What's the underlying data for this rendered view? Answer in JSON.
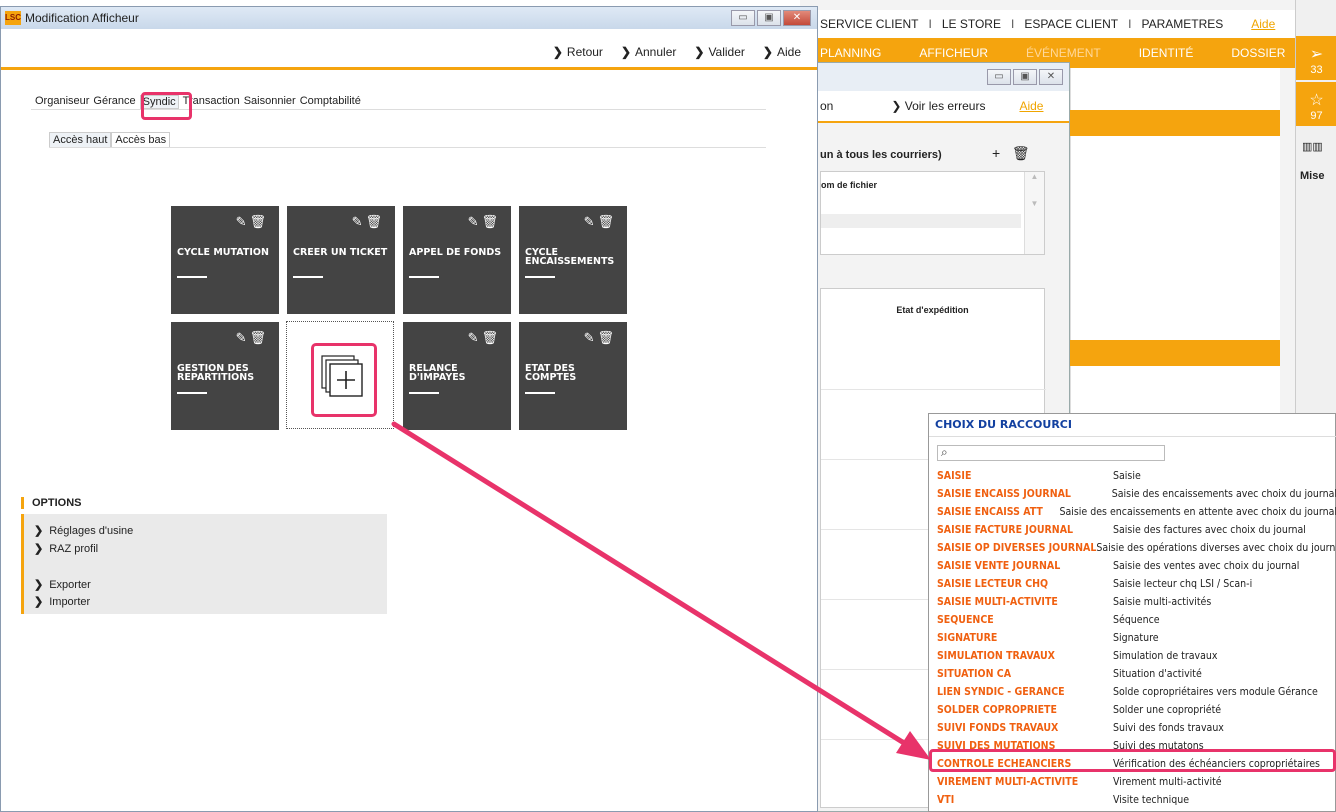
{
  "bg_app": {
    "topnav": [
      "SERVICE CLIENT",
      "LE STORE",
      "ESPACE CLIENT",
      "PARAMETRES"
    ],
    "topnav_sep": "I",
    "aide": "Aide",
    "orangebar": [
      "PLANNING",
      "AFFICHEUR",
      "ÉVÉNEMENT",
      "IDENTITÉ",
      "DOSSIER"
    ],
    "right_counts": [
      "33",
      "97"
    ],
    "right_label": "Mise"
  },
  "mid_window": {
    "toolbar_left": "on",
    "voir_erreurs": "Voir les erreurs",
    "aide": "Aide",
    "sub": "un à tous les courriers)",
    "list_header": "om de fichier",
    "etat_header": "Etat d'expédition"
  },
  "main_window": {
    "title": "Modification Afficheur",
    "logo": "LSC",
    "toolbar": [
      "Retour",
      "Annuler",
      "Valider",
      "Aide"
    ],
    "tabs": [
      "Organiseur",
      "Gérance",
      "Syndic",
      "Transaction",
      "Saisonnier",
      "Comptabilité"
    ],
    "active_tab": "Syndic",
    "subtabs": [
      "Accès haut",
      "Accès bas"
    ],
    "active_subtab": "Accès haut",
    "tiles": [
      "CYCLE MUTATION",
      "CREER UN TICKET",
      "APPEL DE FONDS",
      "CYCLE ENCAISSEMENTS",
      "GESTION DES REPARTITIONS",
      "RELANCE D'IMPAYES",
      "ETAT DES COMPTES"
    ],
    "options_title": "OPTIONS",
    "options": [
      "Réglages d'usine",
      "RAZ profil",
      "Exporter",
      "Importer"
    ]
  },
  "popup": {
    "title": "CHOIX DU RACCOURCI",
    "search_value": "",
    "rows": [
      {
        "code": "SAISIE",
        "desc": "Saisie"
      },
      {
        "code": "SAISIE ENCAISS JOURNAL",
        "desc": "Saisie des encaissements avec choix du journal"
      },
      {
        "code": "SAISIE ENCAISS ATT",
        "desc": "Saisie des encaissements en attente avec choix du journal"
      },
      {
        "code": "SAISIE FACTURE JOURNAL",
        "desc": "Saisie des factures avec choix du journal"
      },
      {
        "code": "SAISIE OP DIVERSES JOURNAL",
        "desc": "Saisie des opérations diverses avec choix du journal"
      },
      {
        "code": "SAISIE VENTE JOURNAL",
        "desc": "Saisie des ventes avec choix du journal"
      },
      {
        "code": "SAISIE LECTEUR CHQ",
        "desc": "Saisie lecteur chq LSI / Scan-i"
      },
      {
        "code": "SAISIE MULTI-ACTIVITE",
        "desc": "Saisie multi-activités"
      },
      {
        "code": "SEQUENCE",
        "desc": "Séquence"
      },
      {
        "code": "SIGNATURE",
        "desc": "Signature"
      },
      {
        "code": "SIMULATION TRAVAUX",
        "desc": "Simulation de travaux"
      },
      {
        "code": "SITUATION CA",
        "desc": "Situation d'activité"
      },
      {
        "code": "LIEN SYNDIC - GERANCE",
        "desc": "Solde copropriétaires vers module Gérance"
      },
      {
        "code": "SOLDER COPROPRIETE",
        "desc": "Solder une copropriété"
      },
      {
        "code": "SUIVI FONDS TRAVAUX",
        "desc": "Suivi des fonds travaux"
      },
      {
        "code": "SUIVI DES MUTATIONS",
        "desc": "Suivi des mutatons"
      },
      {
        "code": "CONTROLE ECHEANCIERS",
        "desc": "Vérification des échéanciers copropriétaires"
      },
      {
        "code": "VIREMENT MULTI-ACTIVITE",
        "desc": "Virement multi-activité"
      },
      {
        "code": "VTI",
        "desc": "Visite technique"
      }
    ],
    "highlighted_code": "CONTROLE ECHEANCIERS"
  },
  "colors": {
    "accent": "#f5a40e",
    "highlight": "#e8336a",
    "tile": "#444444",
    "popup_title": "#1240a0",
    "popup_code": "#f06010"
  },
  "icons": [
    "pencil-icon",
    "trash-icon",
    "add-shortcut-icon",
    "search-icon",
    "chevron-right-icon",
    "send-icon",
    "star-icon",
    "book-icon"
  ]
}
